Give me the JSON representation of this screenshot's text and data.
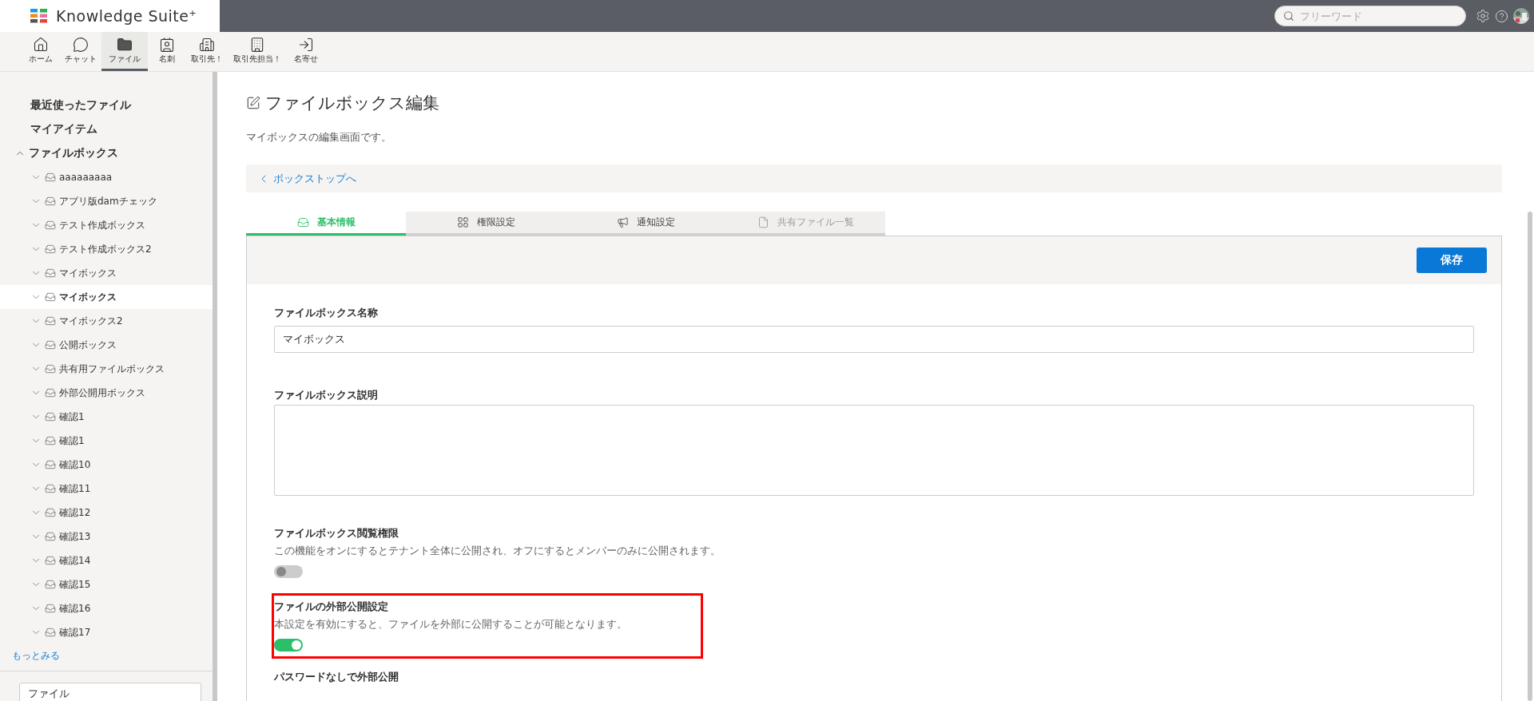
{
  "header": {
    "logo": "Knowledge Suite$^{+}$",
    "search": {
      "placeholder": "フリーワード"
    }
  },
  "nav": [
    {
      "label": "ホーム",
      "selected": false
    },
    {
      "label": "チャット",
      "selected": false
    },
    {
      "label": "ファイル",
      "selected": true
    },
    {
      "label": "名刺",
      "selected": false
    },
    {
      "label": "取引先！",
      "selected": false
    },
    {
      "label": "取引先担当！",
      "selected": false
    },
    {
      "label": "名寄せ",
      "selected": false
    }
  ],
  "sidebar": {
    "links": [
      "最近使ったファイル",
      "マイアイテム"
    ],
    "filebox": {
      "label": "ファイルボックス",
      "expanded": true,
      "children": [
        {
          "label": "aaaaaaaaa",
          "selected": false
        },
        {
          "label": "アプリ版damチェック",
          "selected": false
        },
        {
          "label": "テスト作成ボックス",
          "selected": false
        },
        {
          "label": "テスト作成ボックス2",
          "selected": false
        },
        {
          "label": "マイボックス",
          "selected": false
        },
        {
          "label": "マイボックス",
          "selected": true
        },
        {
          "label": "マイボックス2",
          "selected": false
        },
        {
          "label": "公開ボックス",
          "selected": false
        },
        {
          "label": "共有用ファイルボックス",
          "selected": false
        },
        {
          "label": "外部公開用ボックス",
          "selected": false
        },
        {
          "label": "確認1",
          "selected": false
        },
        {
          "label": "確認1",
          "selected": false
        },
        {
          "label": "確認10",
          "selected": false
        },
        {
          "label": "確認11",
          "selected": false
        },
        {
          "label": "確認12",
          "selected": false
        },
        {
          "label": "確認13",
          "selected": false
        },
        {
          "label": "確認14",
          "selected": false
        },
        {
          "label": "確認15",
          "selected": false
        },
        {
          "label": "確認16",
          "selected": false
        },
        {
          "label": "確認17",
          "selected": false
        }
      ]
    },
    "more": "もっとみる",
    "select": "ファイル"
  },
  "page": {
    "title": "ファイルボックス編集",
    "description": "マイボックスの編集画面です。",
    "back_link": "ボックストップへ",
    "tabs": [
      {
        "label": "基本情報",
        "selected": true,
        "disabled": false
      },
      {
        "label": "権限設定",
        "selected": false,
        "disabled": false
      },
      {
        "label": "通知設定",
        "selected": false,
        "disabled": false
      },
      {
        "label": "共有ファイル一覧",
        "selected": false,
        "disabled": true
      }
    ],
    "save_button": "保存",
    "fields": [
      {
        "kind": "text",
        "label": "ファイルボックス名称",
        "value": "マイボックス"
      },
      {
        "kind": "textarea",
        "label": "ファイルボックス説明"
      }
    ],
    "settings": [
      {
        "kind": "toggle",
        "label": "ファイルボックス閲覧権限",
        "description": "この機能をオンにするとテナント全体に公開され、オフにするとメンバーのみに公開されます。",
        "on": false,
        "highlighted": false
      },
      {
        "kind": "toggle",
        "label": "ファイルの外部公開設定",
        "description": "本設定を有効にすると、ファイルを外部に公開することが可能となります。",
        "on": true,
        "highlighted": true
      },
      {
        "kind": "heading",
        "label": "パスワードなしで外部公開",
        "highlighted": false
      }
    ]
  }
}
